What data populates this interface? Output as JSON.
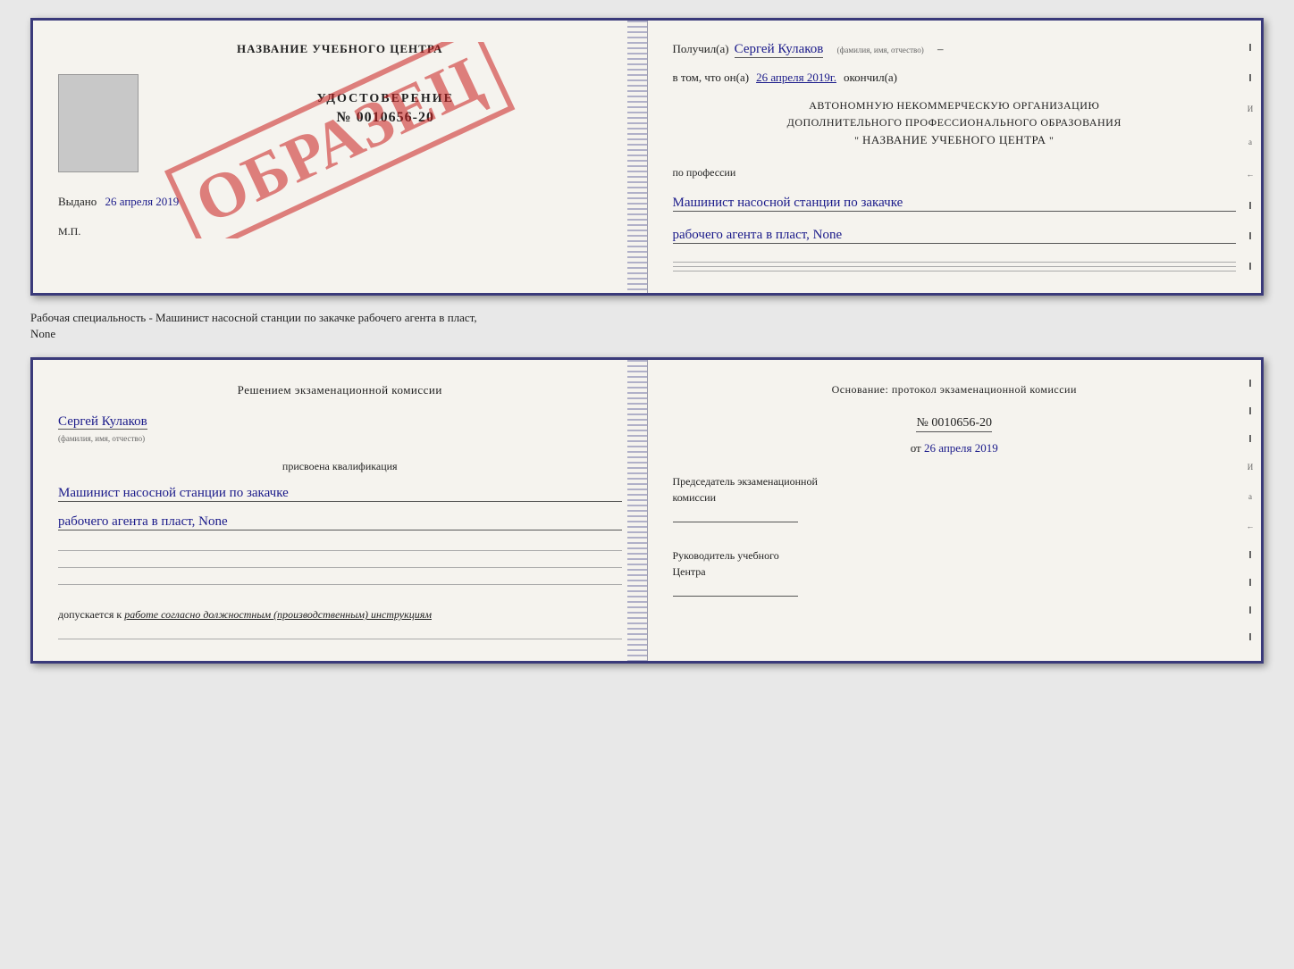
{
  "top_doc": {
    "left": {
      "title": "НАЗВАНИЕ УЧЕБНОГО ЦЕНТРА",
      "watermark": "ОБРАЗЕЦ",
      "udostoverenie_label": "УДОСТОВЕРЕНИЕ",
      "number": "№ 0010656-20",
      "vydano_label": "Выдано",
      "vydano_date": "26 апреля 2019",
      "mp_label": "М.П."
    },
    "right": {
      "poluchil_label": "Получил(а)",
      "recipient_name": "Сергей Кулаков",
      "name_hint": "(фамилия, имя, отчество)",
      "dash": "–",
      "vtom_label": "в том, что он(а)",
      "date": "26 апреля 2019г.",
      "okonchil_label": "окончил(а)",
      "org_line1": "АВТОНОМНУЮ НЕКОММЕРЧЕСКУЮ ОРГАНИЗАЦИЮ",
      "org_line2": "ДОПОЛНИТЕЛЬНОГО ПРОФЕССИОНАЛЬНОГО ОБРАЗОВАНИЯ",
      "org_quote": "\"",
      "org_name": "НАЗВАНИЕ УЧЕБНОГО ЦЕНТРА",
      "org_quote_end": "\"",
      "po_professii_label": "по профессии",
      "qualification_line1": "Машинист насосной станции по закачке",
      "qualification_line2": "рабочего агента в пласт, None",
      "side_dashes": [
        "–",
        "–",
        "–",
        "И",
        "а",
        "←",
        "–",
        "–",
        "–"
      ]
    }
  },
  "separator": {
    "text_line1": "Рабочая специальность - Машинист насосной станции по закачке рабочего агента в пласт,",
    "text_line2": "None"
  },
  "bottom_doc": {
    "left": {
      "resheniem_label": "Решением экзаменационной комиссии",
      "recipient_name": "Сергей Кулаков",
      "name_hint": "(фамилия, имя, отчество)",
      "prisvoena_label": "присвоена квалификация",
      "qualification_line1": "Машинист насосной станции по закачке",
      "qualification_line2": "рабочего агента в пласт, None",
      "blank_lines": [
        "",
        "",
        ""
      ],
      "dopuskaetsya_label": "допускается к",
      "dopusk_text": "работе согласно должностным (производственным) инструкциям",
      "bottom_line": ""
    },
    "right": {
      "osnovanie_label": "Основание: протокол экзаменационной комиссии",
      "number": "№ 0010656-20",
      "ot_label": "от",
      "ot_date": "26 апреля 2019",
      "predsedatel_line1": "Председатель экзаменационной",
      "predsedatel_line2": "комиссии",
      "rukovoditel_line1": "Руководитель учебного",
      "rukovoditel_line2": "Центра",
      "side_dashes": [
        "–",
        "–",
        "–",
        "И",
        "а",
        "←",
        "–",
        "–",
        "–",
        "–"
      ]
    }
  }
}
